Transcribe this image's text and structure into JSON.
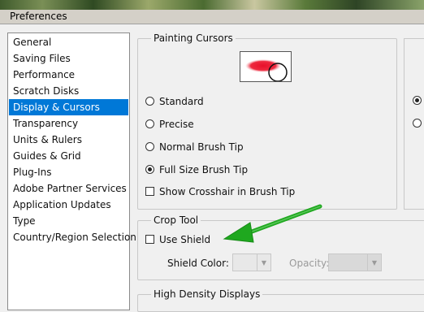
{
  "window": {
    "title": "Preferences"
  },
  "sidebar": {
    "items": [
      {
        "label": "General"
      },
      {
        "label": "Saving Files"
      },
      {
        "label": "Performance"
      },
      {
        "label": "Scratch Disks"
      },
      {
        "label": "Display & Cursors",
        "selected": true
      },
      {
        "label": "Transparency"
      },
      {
        "label": "Units & Rulers"
      },
      {
        "label": "Guides & Grid"
      },
      {
        "label": "Plug-Ins"
      },
      {
        "label": "Adobe Partner Services"
      },
      {
        "label": "Application Updates"
      },
      {
        "label": "Type"
      },
      {
        "label": "Country/Region Selection"
      }
    ]
  },
  "painting_cursors": {
    "title": "Painting Cursors",
    "options": [
      {
        "label": "Standard",
        "checked": false
      },
      {
        "label": "Precise",
        "checked": false
      },
      {
        "label": "Normal Brush Tip",
        "checked": false
      },
      {
        "label": "Full Size Brush Tip",
        "checked": true
      }
    ],
    "show_crosshair": {
      "label": "Show Crosshair in Brush Tip",
      "checked": false
    }
  },
  "crop_tool": {
    "title": "Crop Tool",
    "use_shield": {
      "label": "Use Shield",
      "checked": false
    },
    "shield_color_label": "Shield Color:",
    "opacity_label": "Opacity:"
  },
  "high_density": {
    "title": "High Density Displays"
  },
  "colors": {
    "selection": "#0078d7",
    "annotation_arrow": "#1fa81f",
    "brush_stroke": "#e8102a"
  }
}
